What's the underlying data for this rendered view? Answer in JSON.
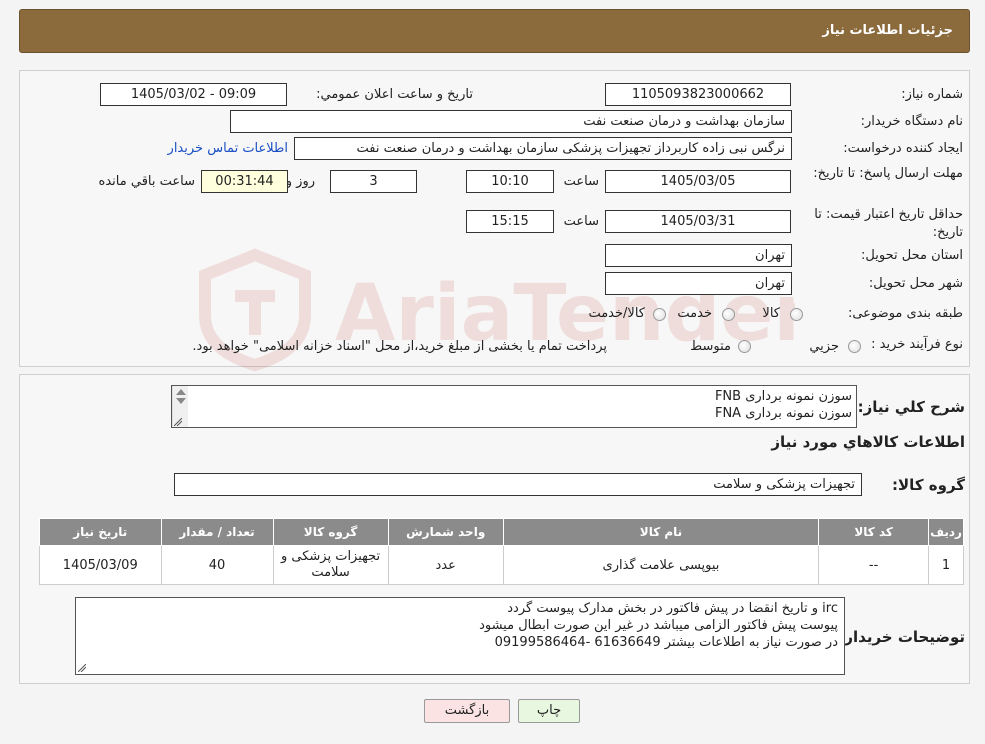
{
  "header": {
    "title": "جزئيات اطلاعات نياز"
  },
  "form": {
    "need_number": {
      "label": "شماره نياز:",
      "value": "1105093823000662"
    },
    "announce_datetime": {
      "label": "تاريخ و ساعت اعلان عمومي:",
      "value": "1405/03/02 - 09:09"
    },
    "buyer_org": {
      "label": "نام دستگاه خريدار:",
      "value": "سازمان بهداشت و درمان صنعت نفت"
    },
    "requester": {
      "label": "ايجاد کننده درخواست:",
      "value": "نرگس نبی زاده کاربرداز تجهیزات پزشکی سازمان بهداشت و درمان صنعت نفت",
      "contact_link": "اطلاعات تماس خريدار"
    },
    "deadline": {
      "label": "مهلت ارسال پاسخ: تا تاريخ:",
      "date": "1405/03/05",
      "time_label": "ساعت",
      "time": "10:10",
      "days": "3",
      "days_label": "روز و",
      "remaining": "00:31:44",
      "remaining_label": "ساعت باقي مانده"
    },
    "price_validity": {
      "label": "حداقل تاريخ اعتبار قيمت: تا تاريخ:",
      "date": "1405/03/31",
      "time_label": "ساعت",
      "time": "15:15"
    },
    "province": {
      "label": "استان محل تحويل:",
      "value": "تهران"
    },
    "city": {
      "label": "شهر محل تحويل:",
      "value": "تهران"
    },
    "category": {
      "label": "طبقه بندی موضوعی:",
      "options": [
        "کالا",
        "خدمت",
        "کالا/خدمت"
      ]
    },
    "process": {
      "label": "نوع فرآيند خريد :",
      "options": [
        "جزيي",
        "متوسط"
      ],
      "note": "پرداخت تمام يا بخشی از مبلغ خريد،از محل \"اسناد خزانه اسلامی\" خواهد بود."
    }
  },
  "summary": {
    "label": "شرح کلي نياز:",
    "lines": [
      "سوزن نمونه برداری FNB",
      "سوزن نمونه برداری FNA"
    ]
  },
  "goods": {
    "section_title": "اطلاعات کالاهاي مورد نياز",
    "group_label": "گروه کالا:",
    "group_value": "تجهيزات پزشکی و سلامت",
    "table": {
      "headers": [
        "رديف",
        "کد کالا",
        "نام کالا",
        "واحد شمارش",
        "گروه کالا",
        "تعداد / مقدار",
        "تاريخ نياز"
      ],
      "rows": [
        {
          "row": "1",
          "code": "--",
          "name": "بیوپسی علامت گذاری",
          "unit": "عدد",
          "group": "تجهيزات پزشکی و سلامت",
          "qty": "40",
          "date": "1405/03/09"
        }
      ]
    }
  },
  "buyer_notes": {
    "label": "توضيحات خريدار:",
    "lines": [
      "irc و تاریخ انقضا در پیش فاکتور در بخش مدارک پیوست گردد",
      "پیوست پیش فاکتور الزامی میباشد در غیر این صورت ابطال میشود",
      "در صورت نیاز به اطلاعات بیشتر 61636649 -09199586464"
    ]
  },
  "buttons": {
    "print": "چاپ",
    "back": "بازگشت"
  },
  "watermark": {
    "text": "AriaTender.neT"
  },
  "colors": {
    "header_bg": "#8b6a3c",
    "table_header_bg": "#8b8b8b",
    "link": "#1a4fc4",
    "print_btn": "#e8f7e0",
    "back_btn": "#fbe3e3"
  }
}
